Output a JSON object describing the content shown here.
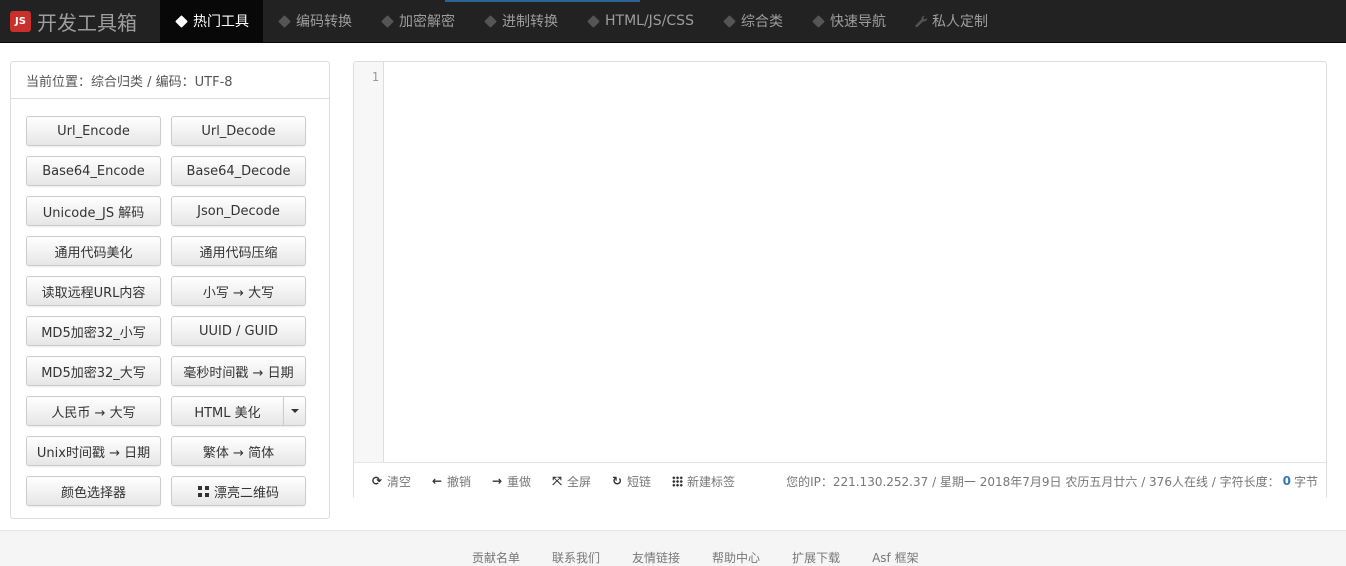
{
  "brand": {
    "logo": "JS",
    "name": "开发工具箱"
  },
  "nav": {
    "items": [
      {
        "label": "热门工具",
        "icon": "tag-icon",
        "active": true
      },
      {
        "label": "编码转换",
        "icon": "tag-icon"
      },
      {
        "label": "加密解密",
        "icon": "tag-icon"
      },
      {
        "label": "进制转换",
        "icon": "tag-icon"
      },
      {
        "label": "HTML/JS/CSS",
        "icon": "tag-icon"
      },
      {
        "label": "综合类",
        "icon": "tag-icon"
      },
      {
        "label": "快速导航",
        "icon": "tag-icon"
      },
      {
        "label": "私人定制",
        "icon": "wrench-icon"
      }
    ]
  },
  "panel": {
    "breadcrumb": "当前位置：综合归类 / 编码：UTF-8",
    "buttons": [
      "Url_Encode",
      "Url_Decode",
      "Base64_Encode",
      "Base64_Decode",
      "Unicode_JS 解码",
      "Json_Decode",
      "通用代码美化",
      "通用代码压缩",
      "读取远程URL内容",
      "小写 → 大写",
      "MD5加密32_小写",
      "UUID / GUID",
      "MD5加密32_大写",
      "毫秒时间戳 → 日期",
      "人民币 → 大写",
      "HTML 美化",
      "Unix时间戳 → 日期",
      "繁体 → 简体",
      "颜色选择器",
      "漂亮二维码"
    ]
  },
  "editor": {
    "line_number": "1",
    "toolbar": {
      "clear": "清空",
      "undo": "撤销",
      "redo": "重做",
      "fullscreen": "全屏",
      "shortlink": "短链",
      "newtab": "新建标签"
    },
    "status": {
      "prefix": "您的IP：221.130.252.37 / 星期一 2018年7月9日 农历五月廿六 / 376人在线 / 字符长度：",
      "char_count": "0",
      "suffix": "字节"
    }
  },
  "footer": {
    "links": [
      "贡献名单",
      "联系我们",
      "友情链接",
      "帮助中心",
      "扩展下载",
      "Asf 框架"
    ]
  },
  "colors": {
    "navbar": "#222222",
    "active_tab": "#080808",
    "accent": "#337ab7",
    "logo": "#c9302c"
  }
}
